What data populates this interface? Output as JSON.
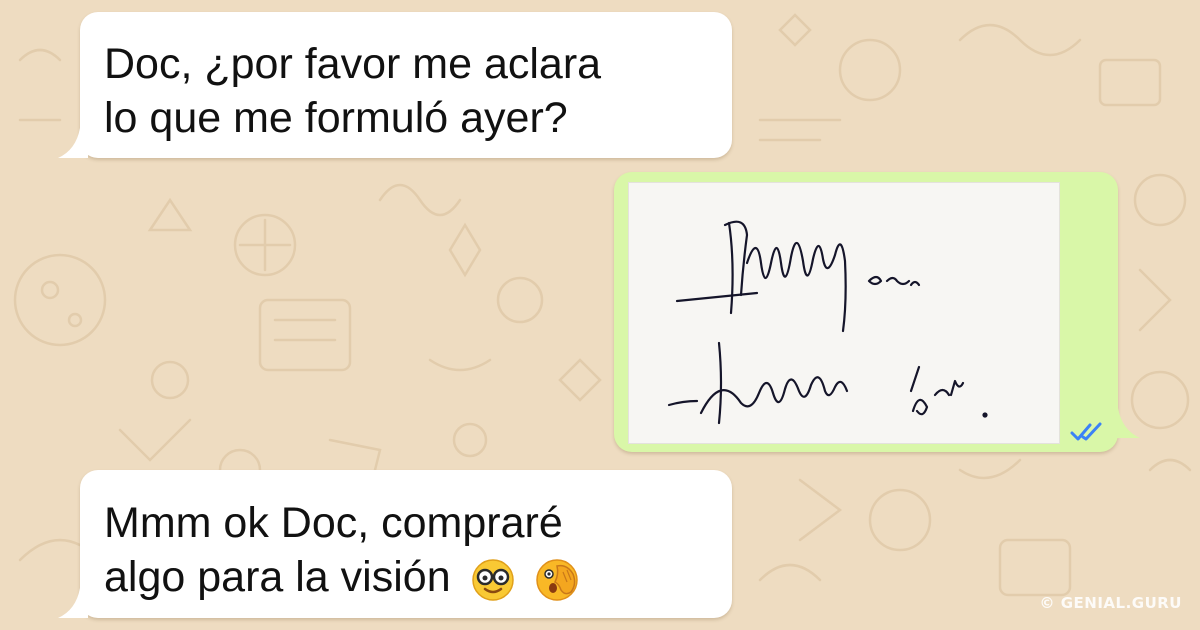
{
  "colors": {
    "wallpaper": "#eedcc1",
    "incoming_bubble": "#ffffff",
    "outgoing_bubble": "#d9f7a8",
    "read_ticks": "#3b82f6"
  },
  "chat": {
    "messages": [
      {
        "direction": "incoming",
        "lines": [
          "Doc, ¿por favor me aclara",
          "lo que me formuló ayer?"
        ]
      },
      {
        "direction": "outgoing",
        "type": "image",
        "image": "handwritten-prescription",
        "status_icon": "double-check-icon",
        "status": "read"
      },
      {
        "direction": "incoming",
        "lines": [
          "Mmm ok Doc, compraré",
          "algo para la visión"
        ],
        "emojis": [
          "nerd-glasses-emoji",
          "face-palm-emoji"
        ]
      }
    ]
  },
  "watermark": "© GENIAL.GURU"
}
